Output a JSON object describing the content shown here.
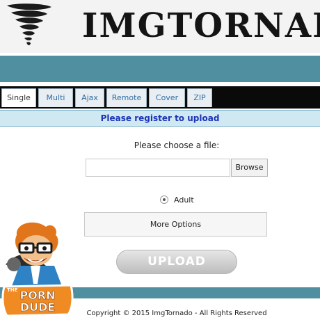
{
  "header": {
    "site_title": "IMGTORNADO"
  },
  "tabs": [
    {
      "label": "Single",
      "active": true
    },
    {
      "label": "Multi",
      "active": false
    },
    {
      "label": "Ajax",
      "active": false
    },
    {
      "label": "Remote",
      "active": false
    },
    {
      "label": "Cover",
      "active": false
    },
    {
      "label": "ZIP",
      "active": false
    }
  ],
  "notice": {
    "register": "Please register to upload"
  },
  "upload_form": {
    "choose_label": "Please choose a file:",
    "file_value": "",
    "browse_label": "Browse",
    "rating_option": "Adult",
    "rating_selected": true,
    "more_options_label": "More Options",
    "upload_label": "UPLOAD"
  },
  "badge": {
    "line1": "THE",
    "line2": "PORN",
    "line3": "DUDE"
  },
  "footer": {
    "copyright": "Copyright © 2015 ImgTornado - All Rights Reserved"
  },
  "colors": {
    "band": "#4f8fa0",
    "register_text": "#1b33b5",
    "register_bg": "#cfe8f2",
    "tabs_bg": "#0a0a0a"
  },
  "icons": {
    "logo": "tornado-icon",
    "mascot": "porn-dude-mascot"
  }
}
